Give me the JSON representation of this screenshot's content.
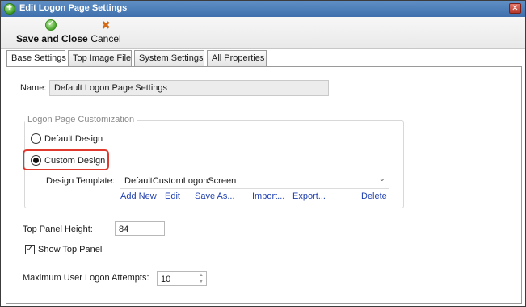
{
  "window": {
    "title": "Edit Logon Page Settings",
    "close_glyph": "✕"
  },
  "toolbar": {
    "save_label": "Save and Close",
    "cancel_label": "Cancel",
    "cancel_glyph": "✖"
  },
  "tabs": [
    {
      "label": "Base Settings",
      "active": true
    },
    {
      "label": "Top Image File",
      "active": false
    },
    {
      "label": "System Settings",
      "active": false
    },
    {
      "label": "All Properties",
      "active": false
    }
  ],
  "form": {
    "name_label": "Name:",
    "name_value": "Default Logon Page Settings",
    "customization": {
      "legend": "Logon Page Customization",
      "default_design_label": "Default Design",
      "custom_design_label": "Custom Design",
      "selected": "Custom Design",
      "template_label": "Design Template:",
      "template_value": "DefaultCustomLogonScreen",
      "links": {
        "add_new": "Add New",
        "edit": "Edit",
        "save_as": "Save As...",
        "import": "Import...",
        "export": "Export...",
        "delete": "Delete"
      }
    },
    "top_panel_height_label": "Top Panel Height:",
    "top_panel_height_value": "84",
    "show_top_panel_label": "Show Top Panel",
    "show_top_panel_checked": true,
    "max_attempts_label": "Maximum User Logon Attempts:",
    "max_attempts_value": "10"
  },
  "colors": {
    "highlight_border": "#e03a2e",
    "link": "#1f3fb0",
    "titlebar": "#4a7bb7"
  },
  "icons": {
    "title": "add-circle-icon",
    "save": "checkmark-circle-icon",
    "cancel": "x-icon"
  }
}
